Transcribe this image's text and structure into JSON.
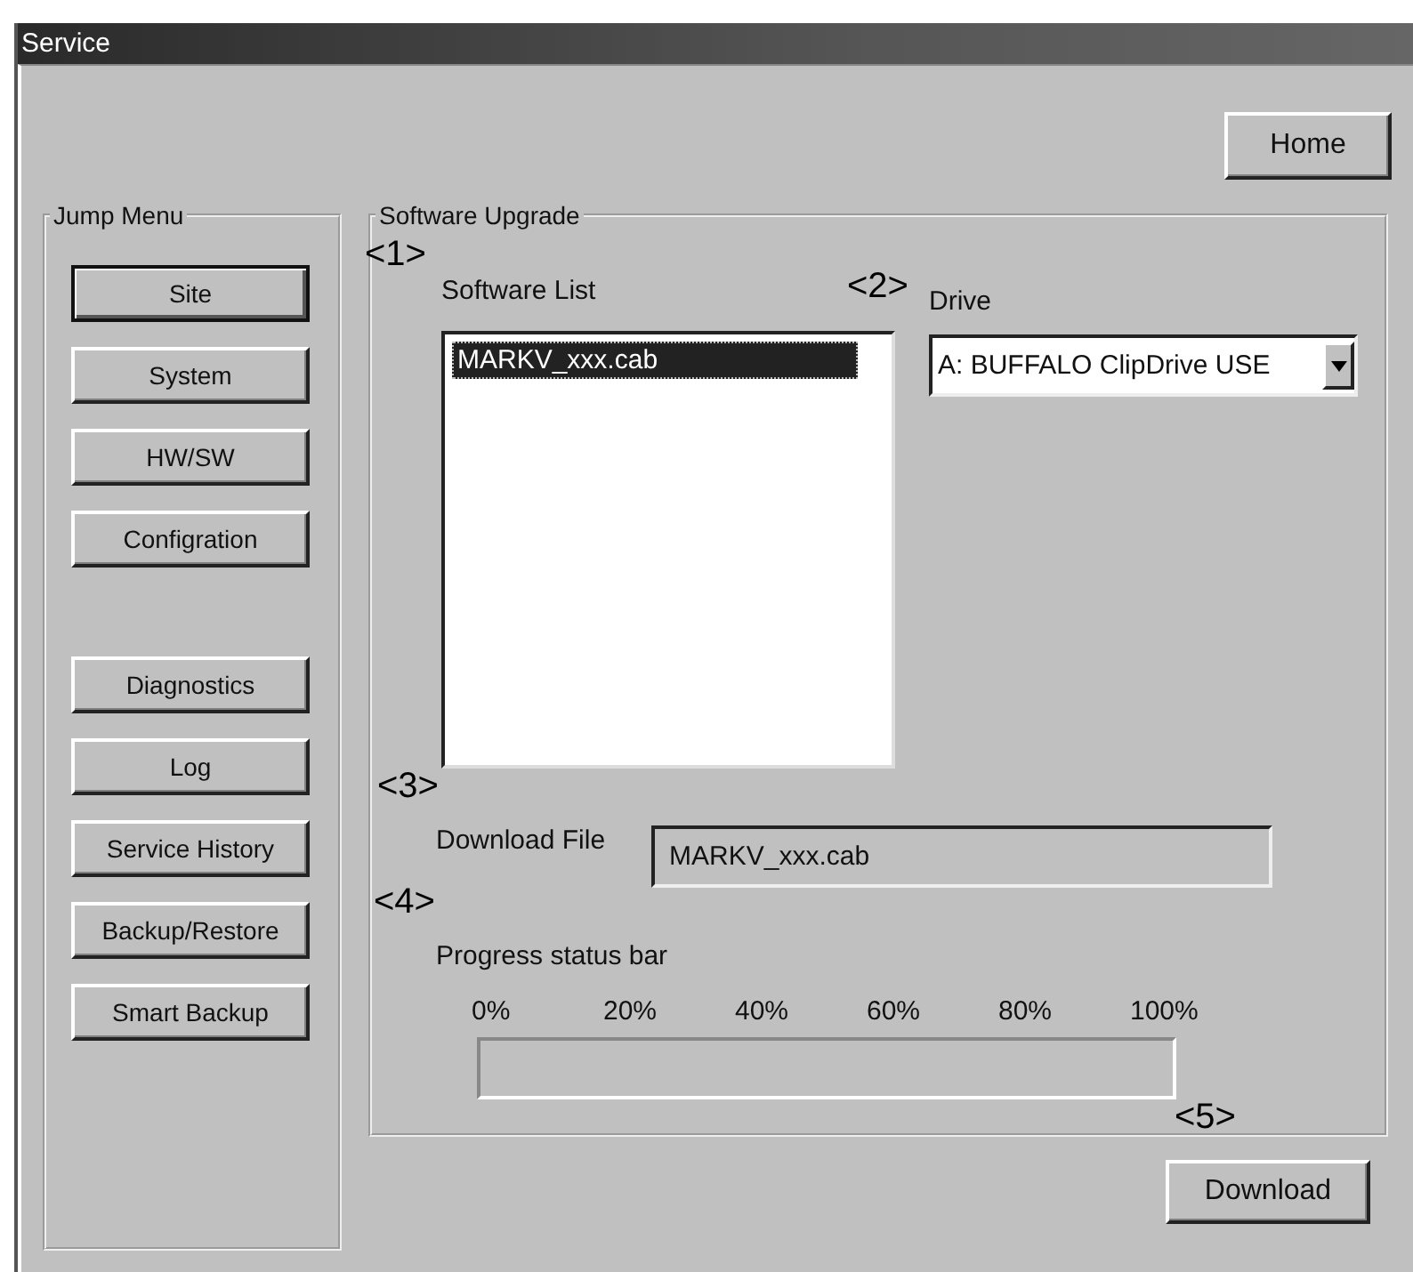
{
  "window": {
    "title": "Service"
  },
  "home_button": "Home",
  "jump_menu": {
    "title": "Jump Menu",
    "groups": [
      [
        {
          "label": "Site",
          "selected": true
        },
        {
          "label": "System",
          "selected": false
        },
        {
          "label": "HW/SW",
          "selected": false
        },
        {
          "label": "Configration",
          "selected": false
        }
      ],
      [
        {
          "label": "Diagnostics",
          "selected": false
        },
        {
          "label": "Log",
          "selected": false
        },
        {
          "label": "Service History",
          "selected": false
        },
        {
          "label": "Backup/Restore",
          "selected": false
        },
        {
          "label": "Smart Backup",
          "selected": false
        }
      ]
    ]
  },
  "software_upgrade": {
    "title": "Software Upgrade",
    "software_list": {
      "label": "Software List",
      "items": [
        {
          "name": "MARKV_xxx.cab",
          "selected": true
        }
      ]
    },
    "drive": {
      "label": "Drive",
      "value": "A: BUFFALO ClipDrive USE"
    },
    "download_file": {
      "label": "Download File",
      "value": "MARKV_xxx.cab"
    },
    "progress": {
      "label": "Progress status bar",
      "ticks": [
        "0%",
        "20%",
        "40%",
        "60%",
        "80%",
        "100%"
      ],
      "level": 0
    },
    "callouts": [
      "<1>",
      "<2>",
      "<3>",
      "<4>",
      "<5>"
    ]
  },
  "download_button": "Download"
}
